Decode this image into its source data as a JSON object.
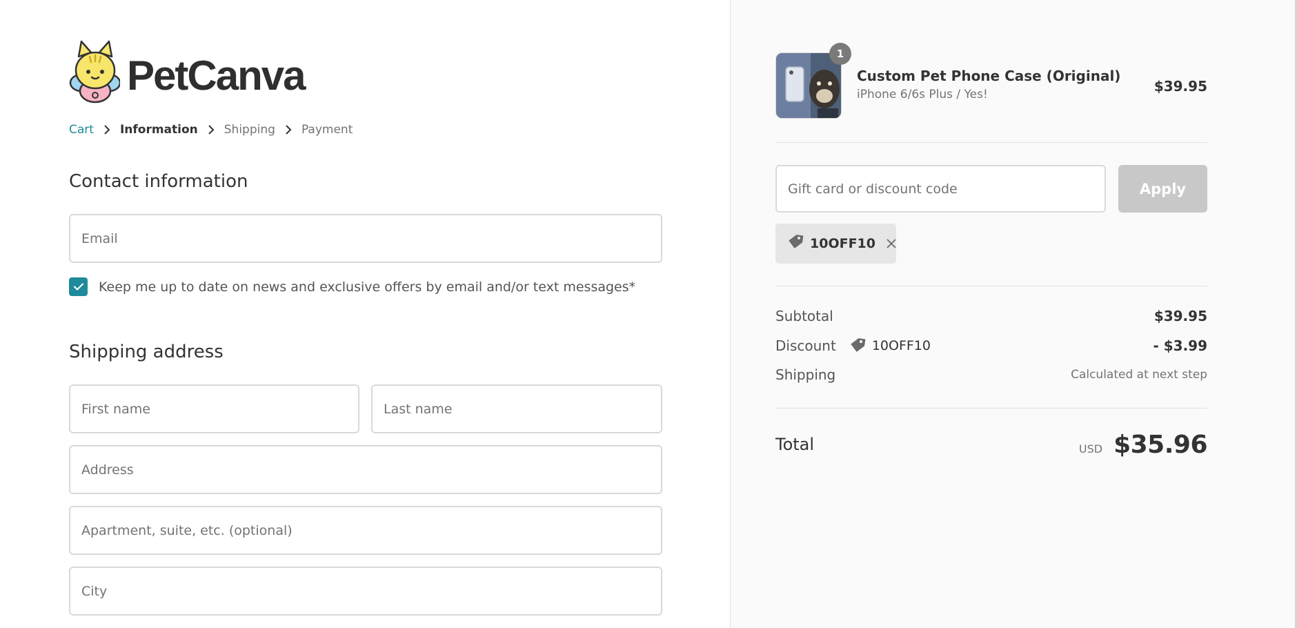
{
  "brand": {
    "name": "PetCanva"
  },
  "breadcrumb": {
    "cart": "Cart",
    "information": "Information",
    "shipping": "Shipping",
    "payment": "Payment"
  },
  "contact": {
    "heading": "Contact information",
    "email_placeholder": "Email",
    "email_value": "",
    "consent_label": "Keep me up to date on news and exclusive offers by email and/or text messages*",
    "consent_checked": true
  },
  "shipping_address": {
    "heading": "Shipping address",
    "first_name_placeholder": "First name",
    "last_name_placeholder": "Last name",
    "address_placeholder": "Address",
    "apartment_placeholder": "Apartment, suite, etc. (optional)",
    "city_placeholder": "City"
  },
  "order": {
    "item": {
      "quantity": "1",
      "name": "Custom Pet Phone Case (Original)",
      "variant": "iPhone 6/6s Plus / Yes!",
      "price": "$39.95"
    },
    "discount_input_placeholder": "Gift card or discount code",
    "apply_label": "Apply",
    "applied_code": "10OFF10",
    "subtotal_label": "Subtotal",
    "subtotal_value": "$39.95",
    "discount_label": "Discount",
    "discount_code": "10OFF10",
    "discount_value": "- $3.99",
    "shipping_label": "Shipping",
    "shipping_value": "Calculated at next step",
    "total_label": "Total",
    "currency": "USD",
    "total_value": "$35.96"
  },
  "colors": {
    "accent": "#1f8a9a",
    "apply_disabled": "#c8c8c8",
    "sidebar_bg": "#fafafa"
  },
  "icons": {
    "logo": "cat-mascot-icon",
    "breadcrumb_separator": "chevron-right-icon",
    "checkbox": "checkmark-icon",
    "discount": "tag-icon",
    "remove": "close-icon"
  }
}
